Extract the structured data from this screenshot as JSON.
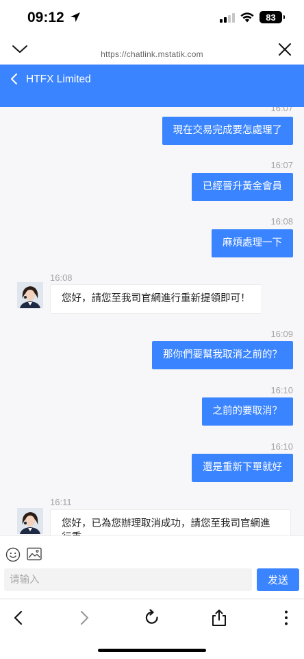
{
  "status_bar": {
    "time": "09:12",
    "battery": "83"
  },
  "browser": {
    "url": "https://chatlink.mstatik.com"
  },
  "header": {
    "title": "HTFX Limited"
  },
  "messages": [
    {
      "time": "16:07",
      "text": "現在交易完成要怎處理了"
    },
    {
      "time": "16:07",
      "text": "已經晉升黃金會員"
    },
    {
      "time": "16:08",
      "text": "麻煩處理一下"
    },
    {
      "time": "16:08",
      "text": "您好，請您至我司官網進行重新提領即可！"
    },
    {
      "time": "16:09",
      "text": "那你們要幫我取消之前的？"
    },
    {
      "time": "16:10",
      "text": "之前的要取消？"
    },
    {
      "time": "16:10",
      "text": "還是重新下單就好"
    },
    {
      "time": "16:11",
      "text": "您好，已為您辦理取消成功，請您至我司官網進行重"
    }
  ],
  "input": {
    "placeholder": "请输入",
    "value": ""
  },
  "send_label": "发送"
}
